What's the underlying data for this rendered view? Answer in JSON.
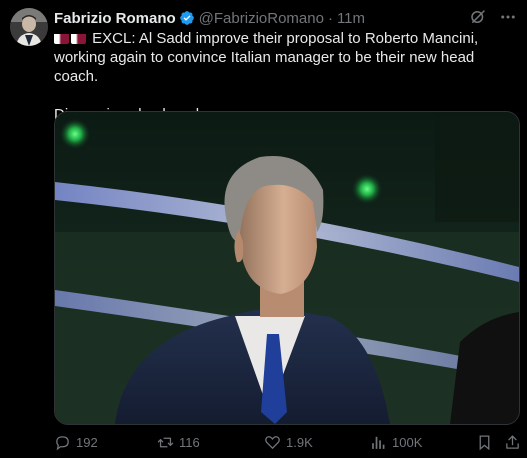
{
  "author": {
    "name": "Fabrizio Romano",
    "handle": "@FabrizioRomano",
    "separator": "·",
    "time": "11m",
    "verified_color": "#1d9bf0"
  },
  "post": {
    "flags": [
      "qatar-flag",
      "qatar-flag"
    ],
    "line1": "EXCL: Al Sadd improve their proposal to Roberto Mancini, working again to convince Italian manager to be their new head coach.",
    "line2": "Discussions back underway."
  },
  "header_icons": [
    "grok-icon",
    "more-icon"
  ],
  "actions": {
    "replies": "192",
    "reposts": "116",
    "likes": "1.9K",
    "views": "100K"
  },
  "colors": {
    "background": "#000000",
    "text": "#e7e9ea",
    "muted": "#71767b"
  }
}
